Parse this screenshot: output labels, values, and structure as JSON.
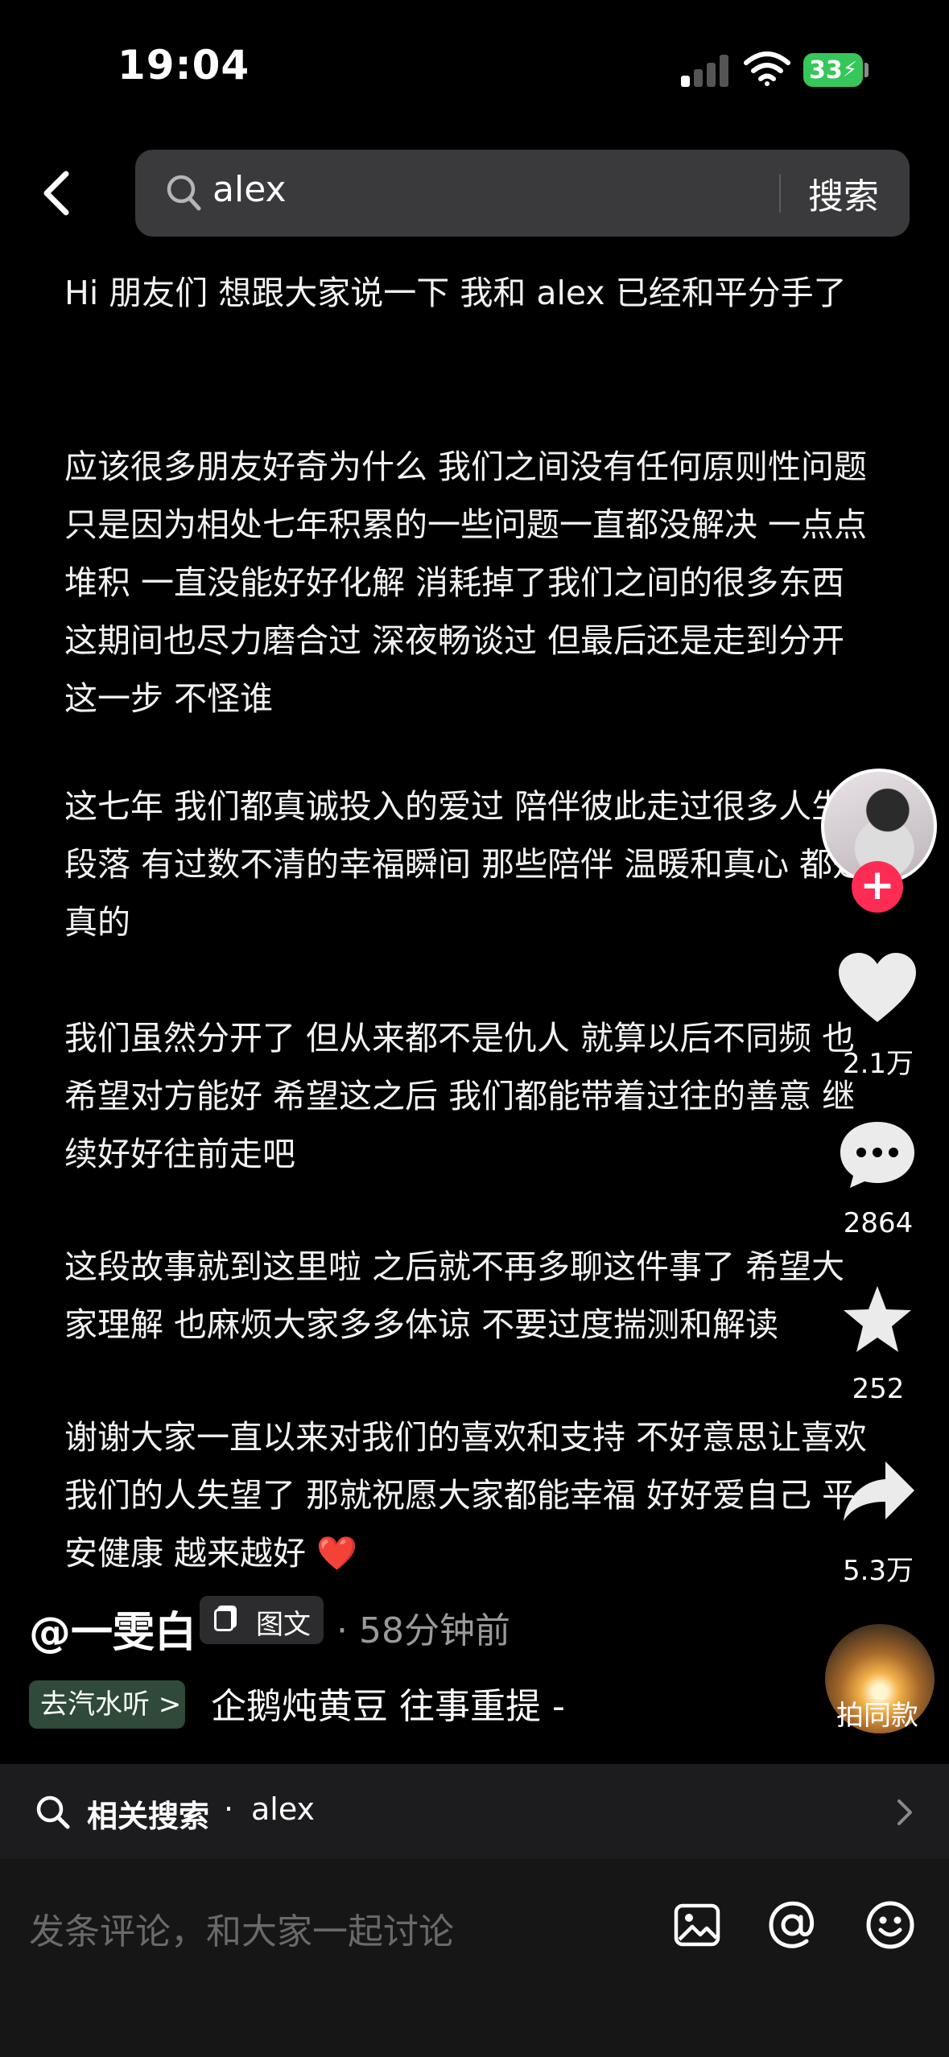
{
  "status_bar": {
    "time": "19:04",
    "battery": "33"
  },
  "search": {
    "query": "alex",
    "button_label": "搜索"
  },
  "post": {
    "paragraphs": [
      "Hi 朋友们 想跟大家说一下 我和 alex 已经和平分手了",
      "应该很多朋友好奇为什么 我们之间没有任何原则性问题 只是因为相处七年积累的一些问题一直都没解决 一点点堆积 一直没能好好化解 消耗掉了我们之间的很多东西 这期间也尽力磨合过 深夜畅谈过 但最后还是走到分开这一步 不怪谁",
      "这七年 我们都真诚投入的爱过 陪伴彼此走过很多人生段落 有过数不清的幸福瞬间 那些陪伴 温暖和真心 都是真的",
      "我们虽然分开了 但从来都不是仇人 就算以后不同频 也希望对方能好 希望这之后 我们都能带着过往的善意 继续好好往前走吧",
      "这段故事就到这里啦 之后就不再多聊这件事了 希望大家理解 也麻烦大家多多体谅 不要过度揣测和解读",
      "谢谢大家一直以来对我们的喜欢和支持 不好意思让喜欢我们的人失望了 那就祝愿大家都能幸福 好好爱自己 平安健康 越来越好 ❤️"
    ],
    "author": "@一雯白",
    "type_label": "图文",
    "timestamp": "· 58分钟前"
  },
  "rail": {
    "follow_symbol": "+",
    "likes": "2.1万",
    "comments": "2864",
    "favorites": "252",
    "shares": "5.3万",
    "same_style": "拍同款"
  },
  "music": {
    "chip": "去汽水听 >",
    "song": "企鹅炖黄豆   往事重提 -"
  },
  "related": {
    "label": "相关搜索",
    "separator": "·",
    "query": "alex"
  },
  "comment": {
    "placeholder": "发条评论，和大家一起讨论"
  },
  "colors": {
    "accent": "#fe2c55",
    "battery": "#35c759",
    "background": "#000000"
  }
}
